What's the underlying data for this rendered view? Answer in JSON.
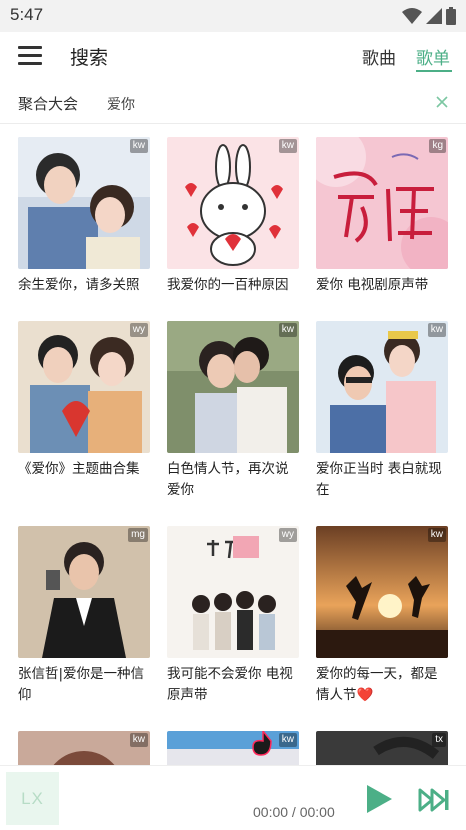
{
  "status_bar": {
    "time": "5:47"
  },
  "app_bar": {
    "title": "搜索",
    "tabs": [
      {
        "label": "歌曲",
        "active": false
      },
      {
        "label": "歌单",
        "active": true
      }
    ],
    "accent_color": "#4caf87"
  },
  "filter": {
    "source": "聚合大会",
    "query": "爱你"
  },
  "playlists": [
    {
      "title": "余生爱你，请多关照",
      "source": "kw",
      "art": "couple-drama"
    },
    {
      "title": "我爱你的一百种原因",
      "source": "kw",
      "art": "bunny-hearts"
    },
    {
      "title": "爱你 电视剧原声带",
      "source": "kg",
      "art": "pink-calligraphy"
    },
    {
      "title": "《爱你》主题曲合集",
      "source": "wy",
      "art": "couple-heart-balloon"
    },
    {
      "title": "白色情人节，再次说爱你",
      "source": "kw",
      "art": "couple-kiss"
    },
    {
      "title": "爱你正当时 表白就现在",
      "source": "kw",
      "art": "couple-piggyback"
    },
    {
      "title": "张信哲|爱你是一种信仰",
      "source": "mg",
      "art": "singer-portrait"
    },
    {
      "title": "我可能不会爱你 电视原声带",
      "source": "wy",
      "art": "drama-poster"
    },
    {
      "title": "爱你的每一天，都是情人节❤️",
      "source": "kw",
      "art": "sunset-jump"
    },
    {
      "title": "",
      "source": "kw",
      "art": "anime-girl"
    },
    {
      "title": "",
      "source": "kw",
      "art": "tiktok-sky"
    },
    {
      "title": "",
      "source": "tx",
      "art": "dark-rain"
    }
  ],
  "player": {
    "logo": "LX",
    "time": "00:00 / 00:00"
  }
}
